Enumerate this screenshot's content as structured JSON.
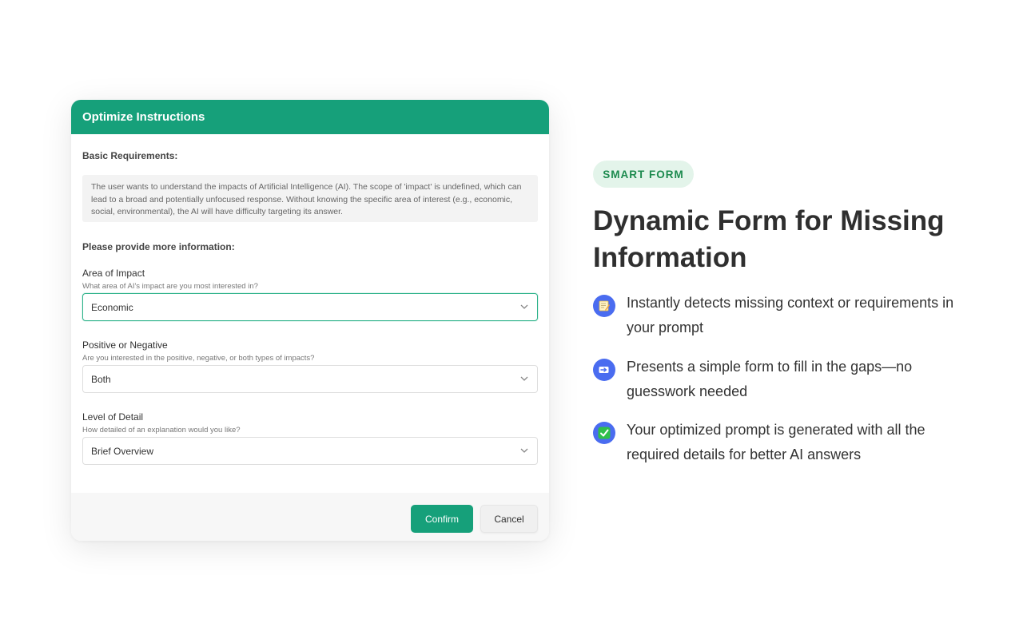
{
  "dialog": {
    "title": "Optimize Instructions",
    "basic_requirements_label": "Basic Requirements:",
    "requirements_text": "The user wants to understand the impacts of Artificial Intelligence (AI). The scope of 'impact' is undefined, which can lead to a broad and potentially unfocused response. Without knowing the specific area of interest (e.g., economic, social, environmental), the AI will have difficulty targeting its answer.",
    "more_info_label": "Please provide more information:",
    "fields": [
      {
        "label": "Area of Impact",
        "hint": "What area of AI's impact are you most interested in?",
        "value": "Economic"
      },
      {
        "label": "Positive or Negative",
        "hint": "Are you interested in the positive, negative, or both types of impacts?",
        "value": "Both"
      },
      {
        "label": "Level of Detail",
        "hint": "How detailed of an explanation would you like?",
        "value": "Brief Overview"
      }
    ],
    "confirm_label": "Confirm",
    "cancel_label": "Cancel"
  },
  "promo": {
    "badge": "SMART FORM",
    "headline": "Dynamic Form for Missing Information",
    "features": [
      {
        "icon": "memo-icon",
        "text": "Instantly detects missing context or requirements in your prompt"
      },
      {
        "icon": "arrow-right-icon",
        "text": "Presents a simple form to fill in the gaps—no guesswork needed"
      },
      {
        "icon": "check-mark-icon",
        "text": "Your optimized prompt is generated with all the required details for better AI answers"
      }
    ]
  },
  "colors": {
    "accent": "#16a07a",
    "badge_bg": "#e3f4ea",
    "badge_text": "#1c8a4e",
    "feature_icon_bg": "#4a6cf0"
  }
}
